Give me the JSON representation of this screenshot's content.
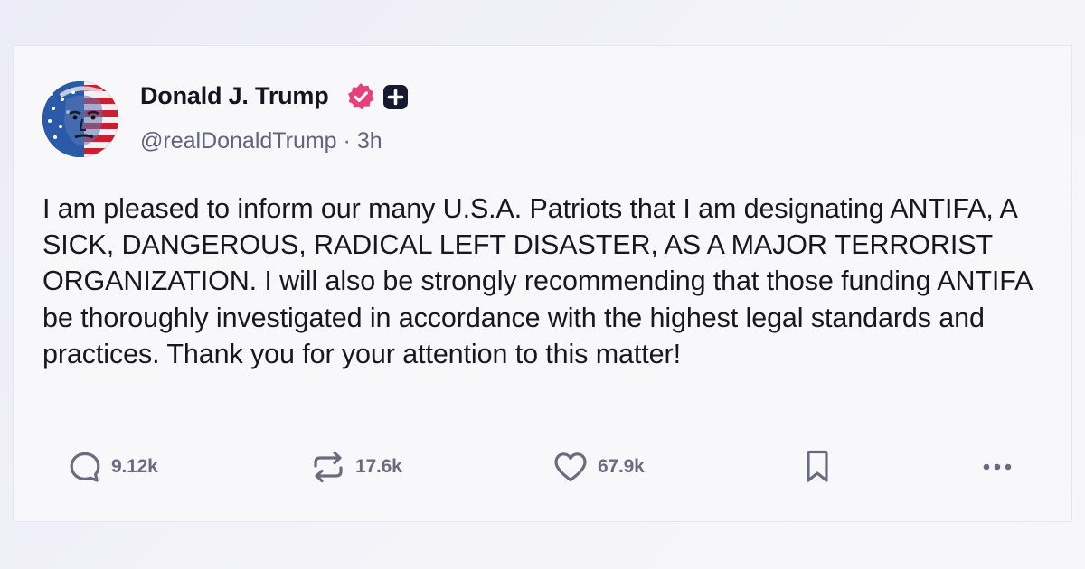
{
  "post": {
    "author": {
      "display_name": "Donald J. Trump",
      "handle": "@realDonaldTrump",
      "separator": "·",
      "time_ago": "3h",
      "verified_color": "#e8407a"
    },
    "body": "I am pleased to inform our many U.S.A. Patriots that I am designating ANTIFA, A SICK, DANGEROUS, RADICAL LEFT DISASTER, AS A MAJOR TERRORIST ORGANIZATION. I will also be strongly recommending that those funding ANTIFA be thoroughly investigated in accordance with the highest legal standards and practices. Thank you for your attention to this matter!",
    "actions": {
      "replies": {
        "icon": "reply-icon",
        "count": "9.12k"
      },
      "reposts": {
        "icon": "repost-icon",
        "count": "17.6k"
      },
      "likes": {
        "icon": "heart-icon",
        "count": "67.9k"
      },
      "bookmark": {
        "icon": "bookmark-icon"
      },
      "more": {
        "icon": "more-icon"
      }
    }
  },
  "colors": {
    "icon_gray": "#6b6b80",
    "text_dark": "#14141f",
    "handle_gray": "#62627a"
  }
}
